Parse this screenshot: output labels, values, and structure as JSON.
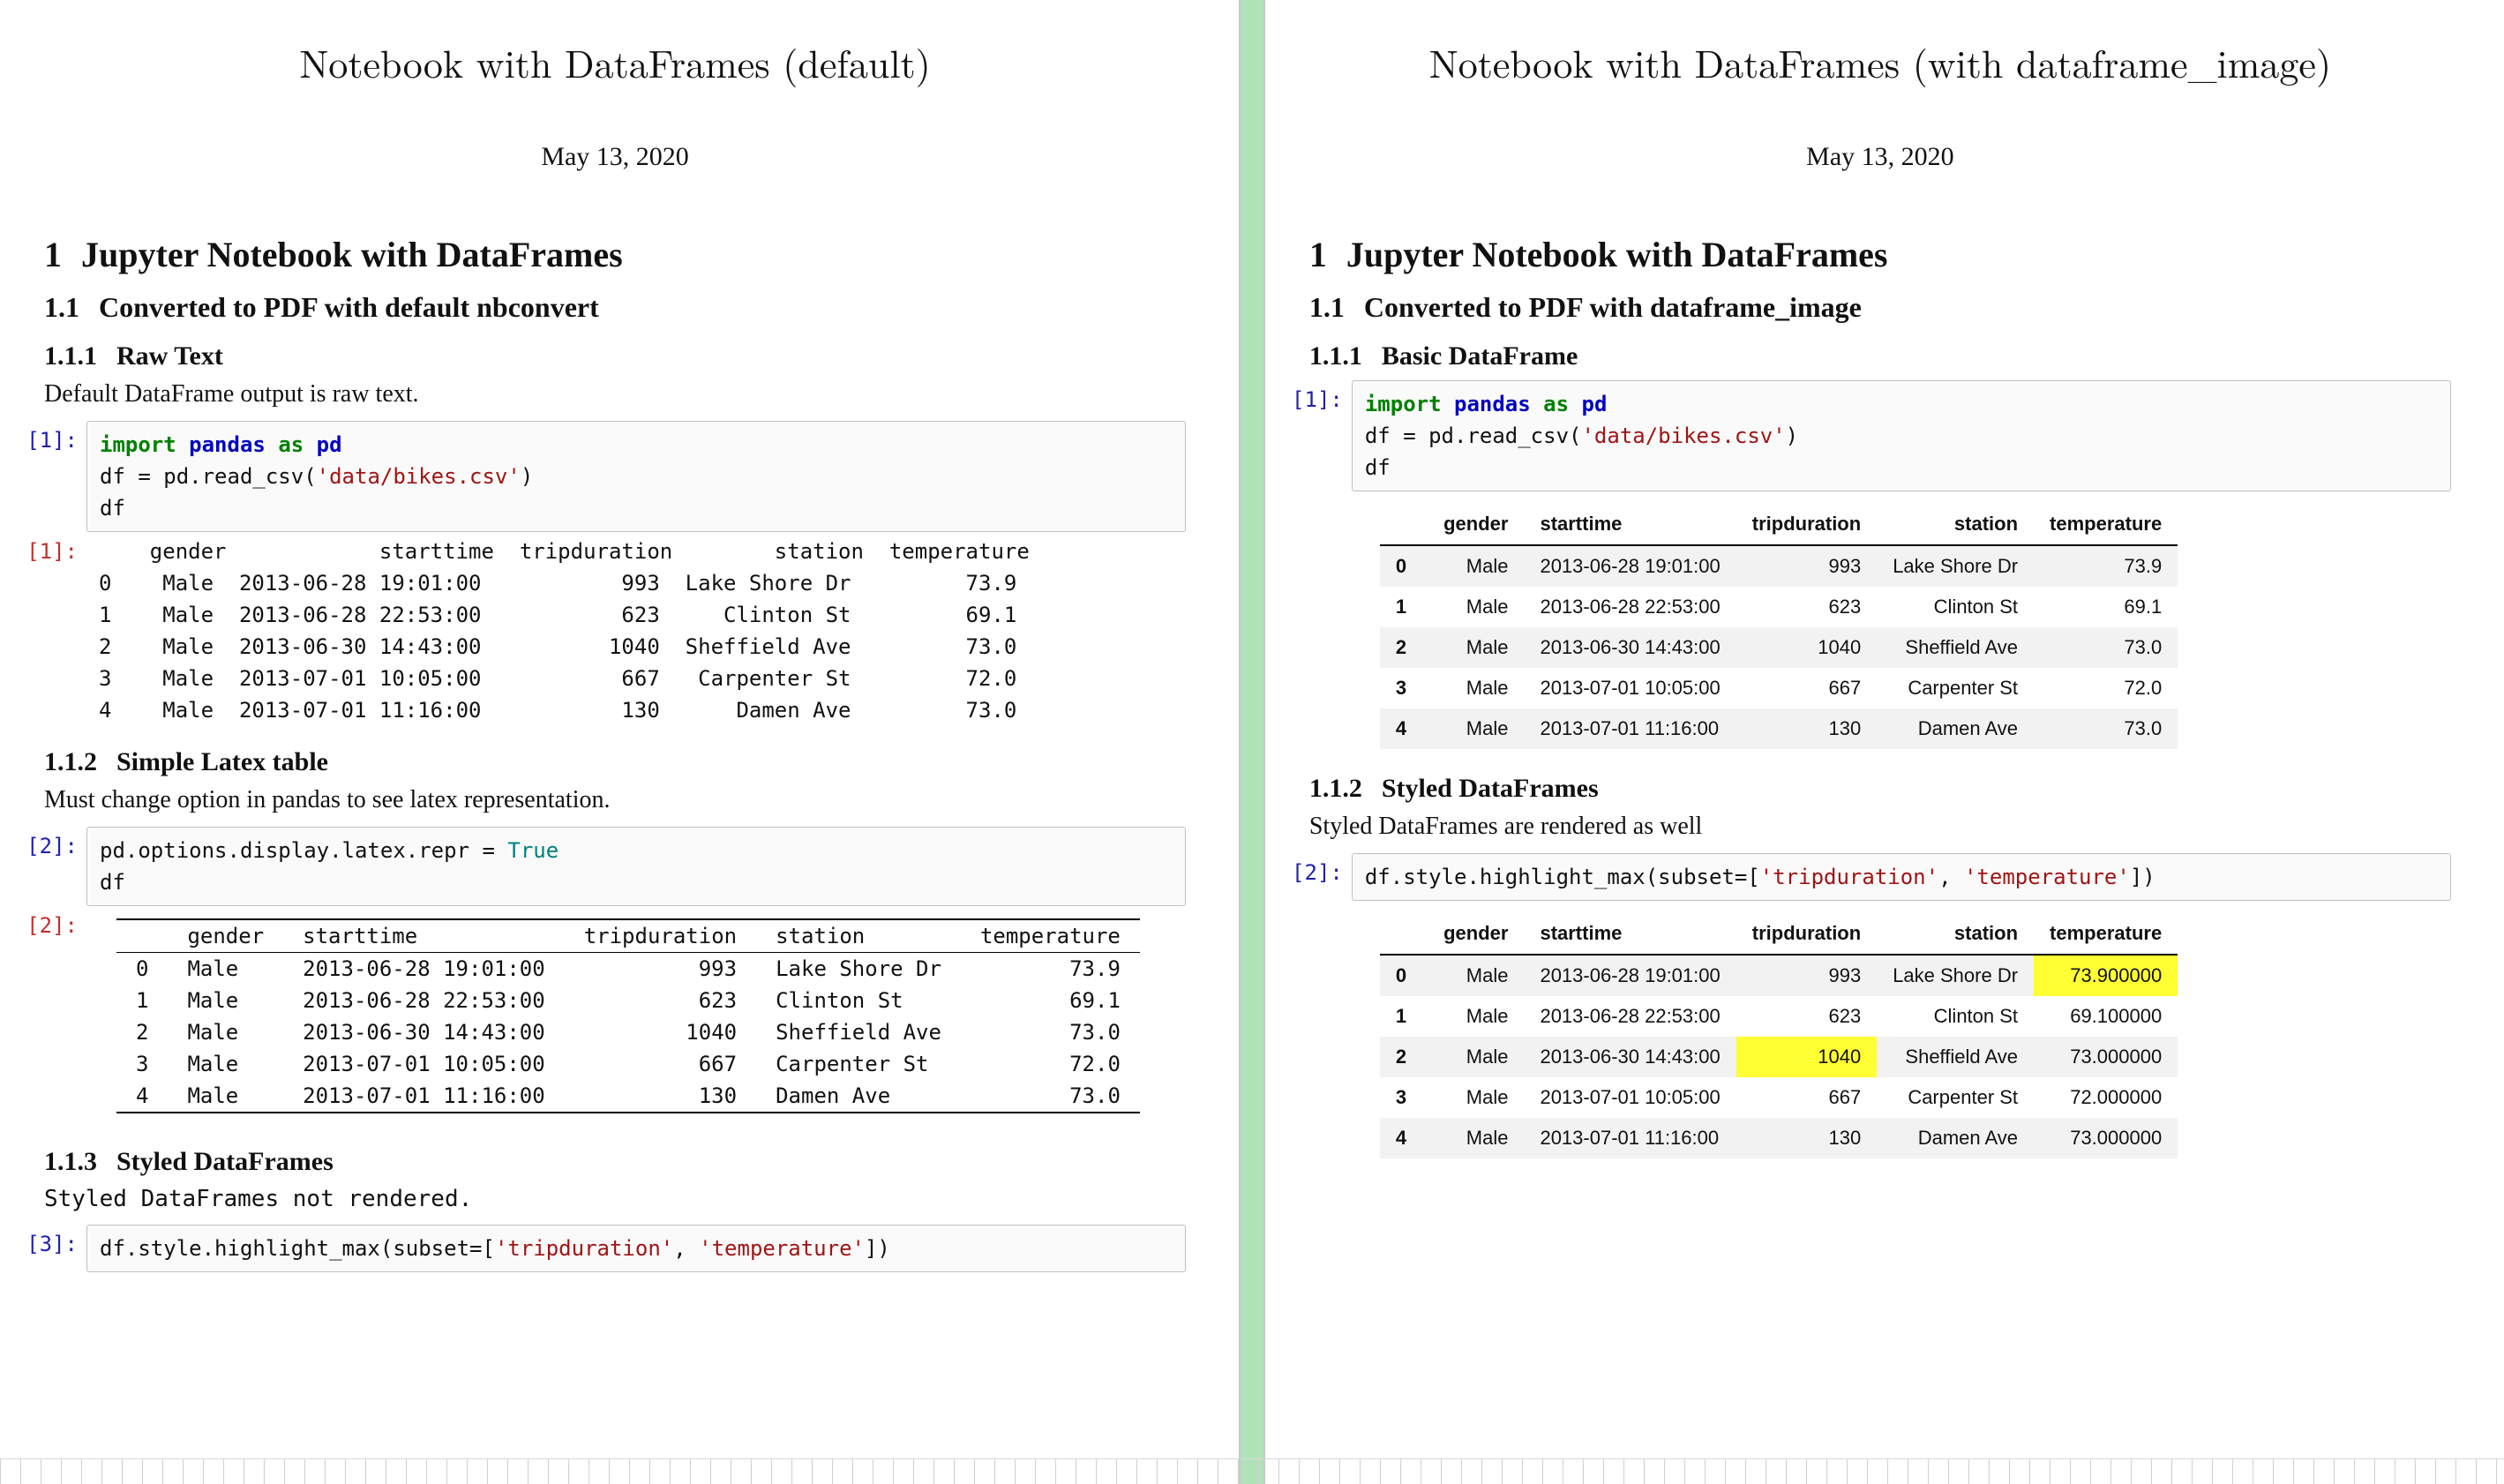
{
  "left": {
    "title": "Notebook with DataFrames (default)",
    "date": "May 13, 2020",
    "h1_num": "1",
    "h1": "Jupyter Notebook with DataFrames",
    "h2_num": "1.1",
    "h2": "Converted to PDF with default nbconvert",
    "sec1_num": "1.1.1",
    "sec1_title": "Raw Text",
    "sec1_body": "Default DataFrame output is raw text.",
    "prompt_in1": "[1]:",
    "code1": {
      "kw_import": "import",
      "pkg": "pandas",
      "kw_as": "as",
      "alias": "pd",
      "line2a": "df = pd.read_csv(",
      "str": "'data/bikes.csv'",
      "line2b": ")",
      "line3": "df"
    },
    "prompt_out1": "[1]:",
    "raw_out_header": "    gender            starttime  tripduration        station  temperature",
    "raw_out_rows": [
      "0    Male  2013-06-28 19:01:00           993  Lake Shore Dr         73.9",
      "1    Male  2013-06-28 22:53:00           623     Clinton St         69.1",
      "2    Male  2013-06-30 14:43:00          1040  Sheffield Ave         73.0",
      "3    Male  2013-07-01 10:05:00           667   Carpenter St         72.0",
      "4    Male  2013-07-01 11:16:00           130      Damen Ave         73.0"
    ],
    "sec2_num": "1.1.2",
    "sec2_title": "Simple Latex table",
    "sec2_body": "Must change option in pandas to see latex representation.",
    "prompt_in2": "[2]:",
    "code2": {
      "line1a": "pd.options.display.latex.repr = ",
      "true": "True",
      "line2": "df"
    },
    "prompt_out2": "[2]:",
    "latex_cols": [
      "",
      "gender",
      "starttime",
      "tripduration",
      "station",
      "temperature"
    ],
    "latex_rows": [
      [
        "0",
        "Male",
        "2013-06-28 19:01:00",
        "993",
        "Lake Shore Dr",
        "73.9"
      ],
      [
        "1",
        "Male",
        "2013-06-28 22:53:00",
        "623",
        "Clinton St",
        "69.1"
      ],
      [
        "2",
        "Male",
        "2013-06-30 14:43:00",
        "1040",
        "Sheffield Ave",
        "73.0"
      ],
      [
        "3",
        "Male",
        "2013-07-01 10:05:00",
        "667",
        "Carpenter St",
        "72.0"
      ],
      [
        "4",
        "Male",
        "2013-07-01 11:16:00",
        "130",
        "Damen Ave",
        "73.0"
      ]
    ],
    "sec3_num": "1.1.3",
    "sec3_title": "Styled DataFrames",
    "sec3_body": "Styled DataFrames not rendered.",
    "prompt_in3": "[3]:",
    "code3": {
      "a": "df.style.highlight_max(subset=[",
      "s1": "'tripduration'",
      "comma": ", ",
      "s2": "'temperature'",
      "b": "])"
    }
  },
  "right": {
    "title": "Notebook with DataFrames (with dataframe_image)",
    "date": "May 13, 2020",
    "h1_num": "1",
    "h1": "Jupyter Notebook with DataFrames",
    "h2_num": "1.1",
    "h2": "Converted to PDF with dataframe_image",
    "sec1_num": "1.1.1",
    "sec1_title": "Basic DataFrame",
    "prompt_in1": "[1]:",
    "code1": {
      "kw_import": "import",
      "pkg": "pandas",
      "kw_as": "as",
      "alias": "pd",
      "line2a": "df = pd.read_csv(",
      "str": "'data/bikes.csv'",
      "line2b": ")",
      "line3": "df"
    },
    "df_cols": [
      "",
      "gender",
      "starttime",
      "tripduration",
      "station",
      "temperature"
    ],
    "df_rows": [
      [
        "0",
        "Male",
        "2013-06-28 19:01:00",
        "993",
        "Lake Shore Dr",
        "73.9"
      ],
      [
        "1",
        "Male",
        "2013-06-28 22:53:00",
        "623",
        "Clinton St",
        "69.1"
      ],
      [
        "2",
        "Male",
        "2013-06-30 14:43:00",
        "1040",
        "Sheffield Ave",
        "73.0"
      ],
      [
        "3",
        "Male",
        "2013-07-01 10:05:00",
        "667",
        "Carpenter St",
        "72.0"
      ],
      [
        "4",
        "Male",
        "2013-07-01 11:16:00",
        "130",
        "Damen Ave",
        "73.0"
      ]
    ],
    "sec2_num": "1.1.2",
    "sec2_title": "Styled DataFrames",
    "sec2_body": "Styled DataFrames are rendered as well",
    "prompt_in2": "[2]:",
    "code2": {
      "a": "df.style.highlight_max(subset=[",
      "s1": "'tripduration'",
      "comma": ", ",
      "s2": "'temperature'",
      "b": "])"
    },
    "df2_cols": [
      "",
      "gender",
      "starttime",
      "tripduration",
      "station",
      "temperature"
    ],
    "df2_rows": [
      [
        "0",
        "Male",
        "2013-06-28 19:01:00",
        "993",
        "Lake Shore Dr",
        "73.900000"
      ],
      [
        "1",
        "Male",
        "2013-06-28 22:53:00",
        "623",
        "Clinton St",
        "69.100000"
      ],
      [
        "2",
        "Male",
        "2013-06-30 14:43:00",
        "1040",
        "Sheffield Ave",
        "73.000000"
      ],
      [
        "3",
        "Male",
        "2013-07-01 10:05:00",
        "667",
        "Carpenter St",
        "72.000000"
      ],
      [
        "4",
        "Male",
        "2013-07-01 11:16:00",
        "130",
        "Damen Ave",
        "73.000000"
      ]
    ],
    "df2_highlight": {
      "row": 2,
      "col": "tripduration",
      "row0temp": true
    }
  }
}
